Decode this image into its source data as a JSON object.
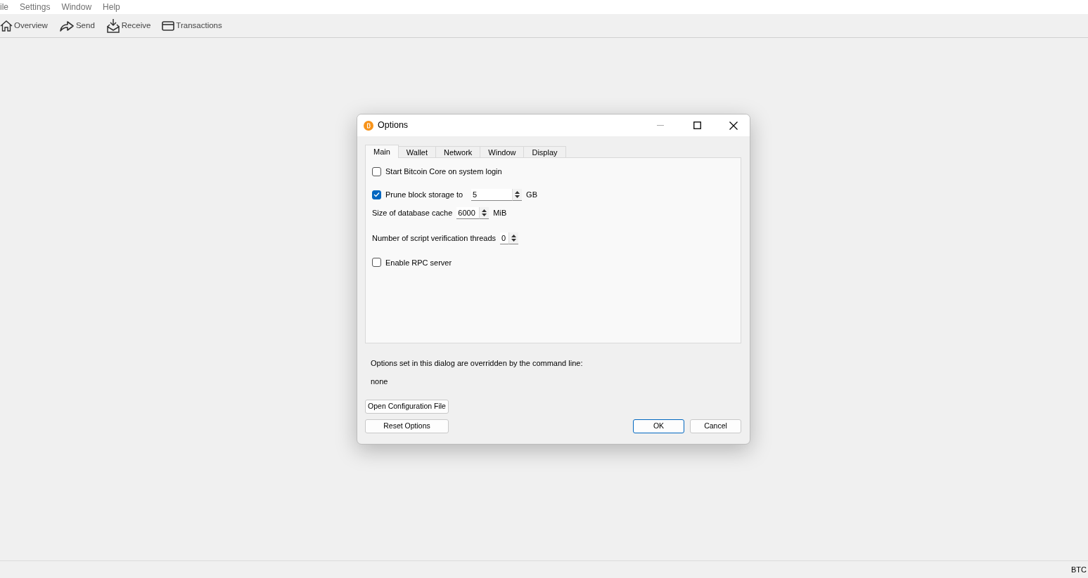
{
  "menu": [
    "ile",
    "Settings",
    "Window",
    "Help"
  ],
  "toolbar": [
    {
      "kind": "home",
      "label": "Overview"
    },
    {
      "kind": "send",
      "label": "Send"
    },
    {
      "kind": "receive",
      "label": "Receive"
    },
    {
      "kind": "card",
      "label": "Transactions"
    }
  ],
  "dialog": {
    "title": "Options",
    "tabs": [
      {
        "label": "Main",
        "selected": true
      },
      {
        "label": "Wallet",
        "selected": false
      },
      {
        "label": "Network",
        "selected": false
      },
      {
        "label": "Window",
        "selected": false
      },
      {
        "label": "Display",
        "selected": false
      }
    ],
    "options": [
      {
        "kind": "checkbox",
        "label": "Start Bitcoin Core on system login",
        "checked": false
      },
      {
        "kind": "checkbox-spin",
        "label": "Prune block storage to",
        "checked": true,
        "value": "5",
        "unit": "GB"
      },
      {
        "kind": "spin",
        "label": "Size of database cache",
        "value": "6000",
        "unit": "MiB"
      },
      {
        "kind": "spin",
        "label": "Number of script verification threads",
        "value": "0"
      },
      {
        "kind": "checkbox",
        "label": "Enable RPC server",
        "checked": false
      }
    ],
    "override_note": "Options set in this dialog are overridden by the command line:",
    "override_value": "none",
    "left_buttons": [
      "Open Configuration File",
      "Reset Options"
    ],
    "buttons": [
      {
        "label": "OK",
        "default": true
      },
      {
        "label": "Cancel",
        "default": false
      }
    ]
  },
  "status_bar": {
    "unit": "BTC"
  }
}
